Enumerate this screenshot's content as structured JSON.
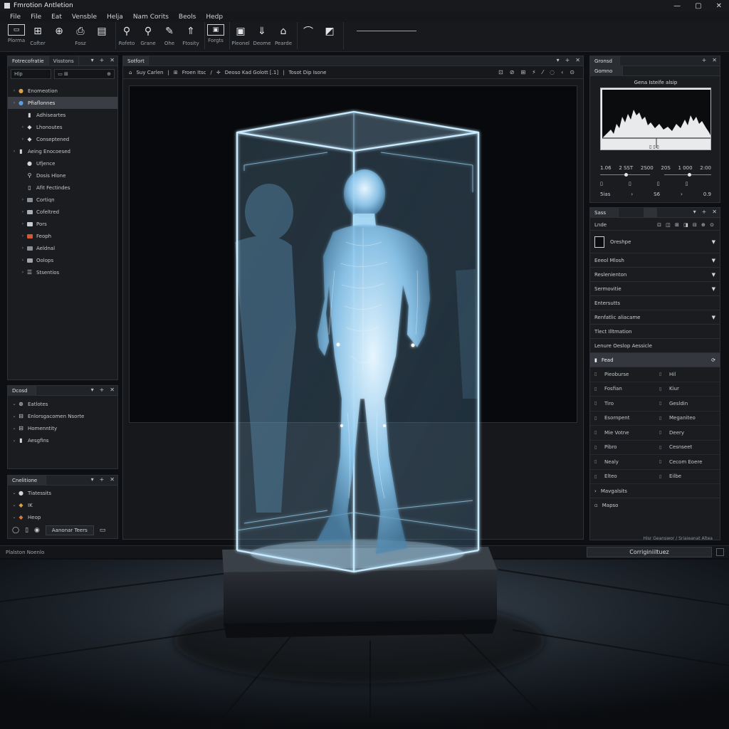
{
  "window": {
    "title": "Fmrotion Antletion",
    "controls": [
      "—",
      "▢",
      "✕"
    ]
  },
  "menu": [
    "File",
    "File",
    "Eat",
    "Vensble",
    "Helja",
    "Nam Corits",
    "Beols",
    "Hedp"
  ],
  "toolbar": {
    "groups": [
      [
        {
          "icon": "display-icon",
          "glyph": "▭",
          "label": "Plorma",
          "wide": true
        },
        {
          "icon": "grid-icon",
          "glyph": "⊞",
          "label": "Cofter"
        },
        {
          "icon": "globe-icon",
          "glyph": "⊕",
          "label": ""
        },
        {
          "icon": "printer-icon",
          "glyph": "⎙",
          "label": "Fosz"
        },
        {
          "icon": "page-icon",
          "glyph": "▤",
          "label": ""
        }
      ],
      [
        {
          "icon": "search-icon",
          "glyph": "⚲",
          "label": "Rofeto"
        },
        {
          "icon": "zoom-icon",
          "glyph": "⚲",
          "label": "Grane"
        },
        {
          "icon": "paint-icon",
          "glyph": "✎",
          "label": "Ohe"
        },
        {
          "icon": "arrow-up-icon",
          "glyph": "⇑",
          "label": "Ftosity"
        }
      ],
      [
        {
          "icon": "image-frame-icon",
          "glyph": "▣",
          "label": "Forgts",
          "wide": true
        }
      ],
      [
        {
          "icon": "picture-icon",
          "glyph": "▣",
          "label": "Pleonel"
        },
        {
          "icon": "download-icon",
          "glyph": "⇓",
          "label": "Deome"
        },
        {
          "icon": "bookmark-icon",
          "glyph": "⌂",
          "label": "Pearde"
        }
      ],
      [
        {
          "icon": "curve-icon",
          "glyph": "⌒",
          "label": ""
        },
        {
          "icon": "camera-icon",
          "glyph": "◩",
          "label": ""
        }
      ]
    ]
  },
  "left_panel": {
    "tabs": [
      "Fotrecofratie",
      "Visstons"
    ],
    "search_value": "Hlp",
    "search2_value": "▭ ⊞",
    "search2_suffix": "⊕",
    "tree": [
      {
        "label": "Enomeotion",
        "arrow": "›",
        "icon": "●",
        "indent": 0,
        "sel": false,
        "iconcolor": "#e0a040"
      },
      {
        "label": "Pfiaflonnes",
        "arrow": "›",
        "icon": "●",
        "indent": 0,
        "sel": true,
        "iconcolor": "#5aa0e0"
      },
      {
        "label": "Adhiseartes",
        "arrow": "",
        "icon": "▮",
        "indent": 1,
        "sel": false,
        "iconcolor": ""
      },
      {
        "label": "Lhonoutes",
        "arrow": "›",
        "icon": "◆",
        "indent": 1,
        "sel": false,
        "iconcolor": ""
      },
      {
        "label": "Conseptened",
        "arrow": "›",
        "icon": "◆",
        "indent": 1,
        "sel": false,
        "iconcolor": ""
      },
      {
        "label": "Aeing Enocoesed",
        "arrow": "›",
        "icon": "▮",
        "indent": 0,
        "sel": false,
        "iconcolor": ""
      },
      {
        "label": "Ufjence",
        "arrow": "",
        "icon": "●",
        "indent": 1,
        "sel": false,
        "iconcolor": ""
      },
      {
        "label": "Dosis Hlone",
        "arrow": "",
        "icon": "⚲",
        "indent": 1,
        "sel": false,
        "iconcolor": ""
      },
      {
        "label": "Afit Fectindes",
        "arrow": "",
        "icon": "▯",
        "indent": 1,
        "sel": false,
        "iconcolor": ""
      },
      {
        "label": "Cortiqn",
        "arrow": "›",
        "icon": "sw",
        "indent": 1,
        "sel": false,
        "iconcolor": "#8b9096"
      },
      {
        "label": "Cofeltred",
        "arrow": "›",
        "icon": "sw",
        "indent": 1,
        "sel": false,
        "iconcolor": "#a9b0b6"
      },
      {
        "label": "Pors",
        "arrow": "›",
        "icon": "sw",
        "indent": 1,
        "sel": false,
        "iconcolor": "#c8cdd2"
      },
      {
        "label": "Feoph",
        "arrow": "›",
        "icon": "sw",
        "indent": 1,
        "sel": false,
        "iconcolor": "#d25a3a"
      },
      {
        "label": "Aeldnal",
        "arrow": "›",
        "icon": "sw",
        "indent": 1,
        "sel": false,
        "iconcolor": "#8b9096"
      },
      {
        "label": "Oolops",
        "arrow": "›",
        "icon": "sw",
        "indent": 1,
        "sel": false,
        "iconcolor": "#a0a6ac"
      },
      {
        "label": "Stsentios",
        "arrow": "›",
        "icon": "☰",
        "indent": 1,
        "sel": false,
        "iconcolor": ""
      }
    ]
  },
  "left_panel2": {
    "tab": "Dcosd",
    "items": [
      {
        "label": "Eatlotes",
        "icon": "⊕"
      },
      {
        "label": "Enlorsgacomen Nsorte",
        "icon": "⊟"
      },
      {
        "label": "Homenntity",
        "icon": "⊟"
      },
      {
        "label": "Aesgfins",
        "icon": "▮"
      }
    ]
  },
  "left_panel3": {
    "tab": "Cnelitione",
    "items": [
      {
        "label": "Tiatessits",
        "icon": "●"
      },
      {
        "label": "IK",
        "icon": "◆",
        "iconcolor": "#e0a040"
      },
      {
        "label": "Heop",
        "icon": "◆",
        "iconcolor": "#d97a3a"
      }
    ],
    "button": "Aanonar Teers"
  },
  "viewport": {
    "tab": "Sotfort",
    "crumbs": [
      "Suy Carlen",
      "Froen Itsc",
      "Deoso Kad Golott [.1]",
      "Tosot Dip Isone"
    ],
    "tools": [
      "⊡",
      "⊘",
      "⊞",
      "⚡",
      "⁄",
      "◌",
      "‹",
      "⊙"
    ]
  },
  "hist_panel": {
    "tab1": "Gronsd",
    "tab2": "Gomno",
    "title": "Gena Isteife alsip",
    "row1": [
      "1.06",
      "2 SST",
      "2S00",
      "20S",
      "1 000",
      "2:00"
    ],
    "row2": [
      "5ias",
      "S6",
      "0.9"
    ]
  },
  "prop_panel": {
    "tab": "Sass",
    "sub": "Lnde",
    "header": "Oreshpe",
    "rows": [
      {
        "label": "Eeeol Mlosh",
        "dd": true
      },
      {
        "label": "Reslenienton",
        "dd": true
      },
      {
        "label": "Sermovitie",
        "dd": true
      },
      {
        "label": "Entersutts",
        "dd": false
      },
      {
        "label": "Renfatlic aliacame",
        "dd": true
      },
      {
        "label": "Tlect Illtmation",
        "dd": false
      },
      {
        "label": "Lenure Oeslop Aessicle",
        "dd": false
      }
    ],
    "highlight": "Fead",
    "grid": [
      [
        "Pieoburse",
        "Hil"
      ],
      [
        "Fosfian",
        "Kiur"
      ],
      [
        "Tiro",
        "Gesldin"
      ],
      [
        "Esornpent",
        "Meganiteo"
      ],
      [
        "Mie Votne",
        "Deery"
      ],
      [
        "Pibro",
        "Cesnseet"
      ],
      [
        "Nealy",
        "Cecom Eoere"
      ],
      [
        "Elteo",
        "Eilbe"
      ]
    ],
    "footer": [
      "Mavgalsits",
      "Mapso"
    ],
    "bottom_note": "Hisr Geanswor / Sriaieanat Altea"
  },
  "status": {
    "left": "Plalston Noenlo",
    "button": "Corriginiiltuez"
  },
  "colors": {
    "accent": "#7fd4ff",
    "hologram": "#a9dcff",
    "panel": "#1a1c1f"
  }
}
